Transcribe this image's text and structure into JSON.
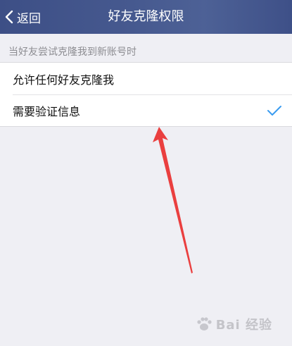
{
  "header": {
    "back_label": "返回",
    "title": "好友克隆权限"
  },
  "section": {
    "header": "当好友尝试克隆我到新账号时",
    "options": [
      {
        "label": "允许任何好友克隆我",
        "selected": false
      },
      {
        "label": "需要验证信息",
        "selected": true
      }
    ]
  },
  "colors": {
    "header_bg": "#44578d",
    "checkmark": "#3a9cf0",
    "annotation_arrow": "#ea3f3f"
  },
  "icons": {
    "back": "chevron-left-icon",
    "selected": "checkmark-icon"
  },
  "watermark": {
    "text": "Bai 经验"
  }
}
